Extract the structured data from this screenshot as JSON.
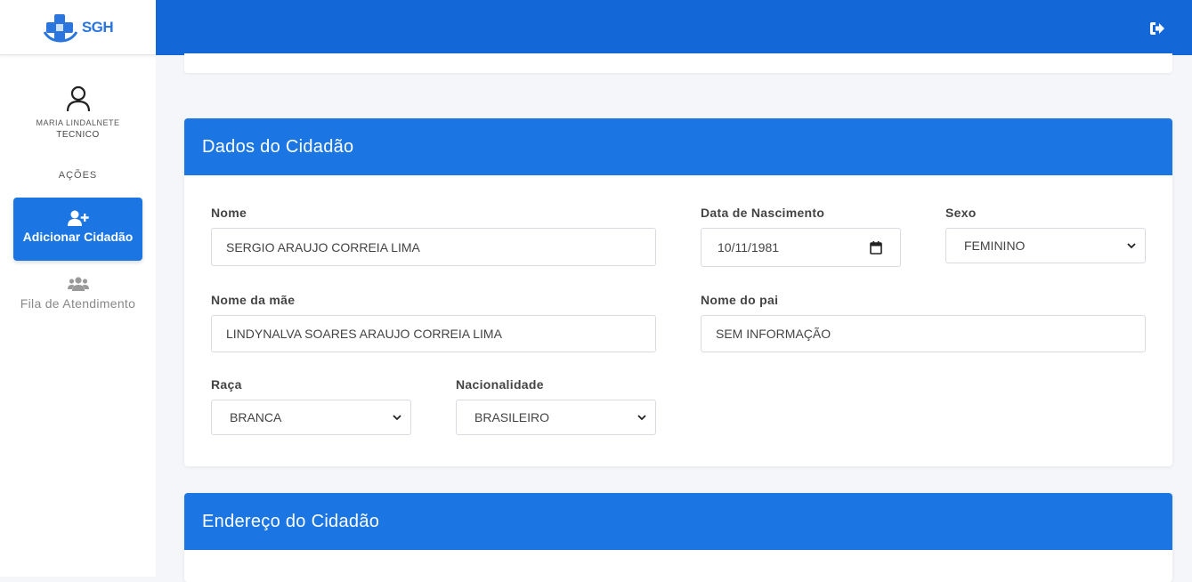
{
  "logo": {
    "text": "SGH"
  },
  "user": {
    "name": "MARIA LINDALNETE",
    "role": "TECNICO"
  },
  "sidebar": {
    "actions_label": "AÇÕES",
    "items": [
      {
        "label": "Adicionar Cidadão",
        "icon": "user-plus-icon",
        "active": true
      },
      {
        "label": "Fila de Atendimento",
        "icon": "users-icon",
        "active": false
      }
    ]
  },
  "header": {
    "logout_icon": "sign-out-icon"
  },
  "citizen_section": {
    "title": "Dados do Cidadão",
    "nome": {
      "label": "Nome",
      "value": "SERGIO ARAUJO CORREIA LIMA"
    },
    "nascimento": {
      "label": "Data de Nascimento",
      "value": "10/11/1981"
    },
    "sexo": {
      "label": "Sexo",
      "value": "FEMININO"
    },
    "mae": {
      "label": "Nome da mãe",
      "value": "LINDYNALVA SOARES ARAUJO CORREIA LIMA"
    },
    "pai": {
      "label": "Nome do pai",
      "value": "SEM INFORMAÇÃO"
    },
    "raca": {
      "label": "Raça",
      "value": "BRANCA"
    },
    "nacionalidade": {
      "label": "Nacionalidade",
      "value": "BRASILEIRO"
    }
  },
  "address_section": {
    "title": "Endereço do Cidadão"
  },
  "colors": {
    "primary": "#1b76e3",
    "topbar": "#1467d6",
    "background": "#f4f6f9"
  }
}
